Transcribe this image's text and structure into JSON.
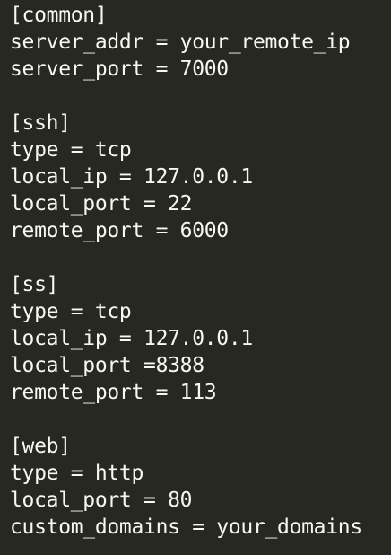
{
  "editor": {
    "colors": {
      "background": "#272822",
      "text": "#F8F8F2"
    },
    "lines": [
      "[common]",
      "server_addr = your_remote_ip",
      "server_port = 7000",
      "",
      "[ssh]",
      "type = tcp",
      "local_ip = 127.0.0.1",
      "local_port = 22",
      "remote_port = 6000",
      "",
      "[ss]",
      "type = tcp",
      "local_ip = 127.0.0.1",
      "local_port =8388",
      "remote_port = 113",
      "",
      "[web]",
      "type = http",
      "local_port = 80",
      "custom_domains = your_domains"
    ]
  }
}
